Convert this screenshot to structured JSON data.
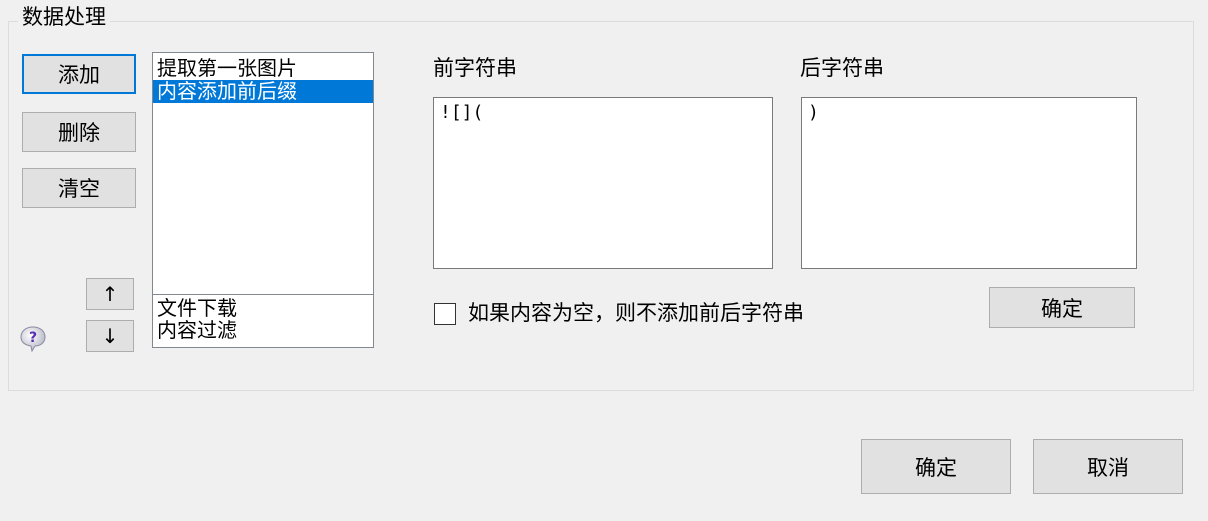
{
  "group": {
    "title": "数据处理"
  },
  "left_buttons": {
    "add": "添加",
    "delete": "删除",
    "clear": "清空"
  },
  "move_buttons": {
    "up": "↑",
    "down": "↓"
  },
  "process_list": {
    "top_items": [
      {
        "label": "提取第一张图片",
        "selected": false
      },
      {
        "label": "内容添加前后缀",
        "selected": true
      }
    ],
    "bottom_items": [
      {
        "label": "文件下载"
      },
      {
        "label": "内容过滤"
      }
    ]
  },
  "prefix": {
    "label": "前字符串",
    "value": "![]("
  },
  "suffix": {
    "label": "后字符串",
    "value": ")"
  },
  "checkbox": {
    "label": "如果内容为空，则不添加前后字符串",
    "checked": false
  },
  "apply_button": {
    "label": "确定"
  },
  "footer": {
    "ok": "确定",
    "cancel": "取消"
  }
}
